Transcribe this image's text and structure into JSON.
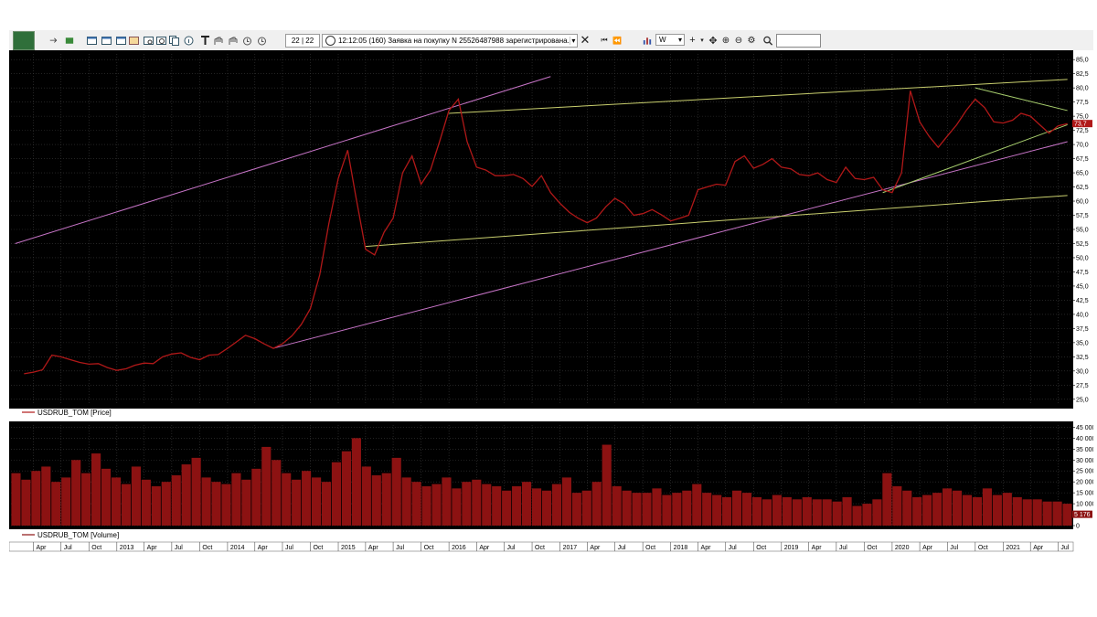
{
  "toolbar": {
    "counter": "22 | 22",
    "message": "12:12:05  (160) Заявка на покупку N 25526487988 зарегистрирована.",
    "timeframe": "W",
    "icons": [
      "app-icon",
      "arrow-icon",
      "connect-icon",
      "window-icon",
      "window-icon",
      "window-icon",
      "portfolio-icon",
      "search-doc-icon",
      "zoom-doc-icon",
      "copy-icon",
      "info-icon",
      "text-tool-icon",
      "hand-icon",
      "hand-icon",
      "alarm-icon",
      "close-icon",
      "first-bar-icon",
      "prev-bar-icon",
      "chart-type-icon",
      "crosshair-icon",
      "move-icon",
      "zoom-in-icon",
      "zoom-out-icon",
      "settings-icon",
      "magnifier-icon"
    ]
  },
  "chart_data": [
    {
      "type": "line",
      "legend": "USDRUB_TOM [Price]",
      "color": "#b01818",
      "ylim": [
        24,
        86
      ],
      "y_ticks": [
        "25,0",
        "27,5",
        "30,0",
        "32,5",
        "35,0",
        "37,5",
        "40,0",
        "42,5",
        "45,0",
        "47,5",
        "50,0",
        "52,5",
        "55,0",
        "57,5",
        "60,0",
        "62,5",
        "65,0",
        "67,5",
        "70,0",
        "72,5",
        "75,0",
        "77,5",
        "80,0",
        "82,5",
        "85,0"
      ],
      "last_value": "73,7",
      "points": [
        [
          "2012-03",
          29.5
        ],
        [
          "2012-04",
          29.8
        ],
        [
          "2012-05",
          30.2
        ],
        [
          "2012-06",
          32.8
        ],
        [
          "2012-07",
          32.5
        ],
        [
          "2012-08",
          32.0
        ],
        [
          "2012-09",
          31.5
        ],
        [
          "2012-10",
          31.2
        ],
        [
          "2012-11",
          31.3
        ],
        [
          "2012-12",
          30.6
        ],
        [
          "2013-01",
          30.1
        ],
        [
          "2013-02",
          30.4
        ],
        [
          "2013-03",
          31.0
        ],
        [
          "2013-04",
          31.4
        ],
        [
          "2013-05",
          31.3
        ],
        [
          "2013-06",
          32.5
        ],
        [
          "2013-07",
          33.0
        ],
        [
          "2013-08",
          33.2
        ],
        [
          "2013-09",
          32.4
        ],
        [
          "2013-10",
          32.0
        ],
        [
          "2013-11",
          32.8
        ],
        [
          "2013-12",
          32.9
        ],
        [
          "2014-01",
          34.0
        ],
        [
          "2014-02",
          35.2
        ],
        [
          "2014-03",
          36.3
        ],
        [
          "2014-04",
          35.7
        ],
        [
          "2014-05",
          34.8
        ],
        [
          "2014-06",
          34.0
        ],
        [
          "2014-07",
          34.8
        ],
        [
          "2014-08",
          36.2
        ],
        [
          "2014-09",
          38.2
        ],
        [
          "2014-10",
          41.0
        ],
        [
          "2014-11",
          47.0
        ],
        [
          "2014-12",
          56.0
        ],
        [
          "2015-01",
          64.0
        ],
        [
          "2015-02",
          69.0
        ],
        [
          "2015-03",
          60.5
        ],
        [
          "2015-04",
          51.5
        ],
        [
          "2015-05",
          50.5
        ],
        [
          "2015-06",
          54.5
        ],
        [
          "2015-07",
          57.0
        ],
        [
          "2015-08",
          65.0
        ],
        [
          "2015-09",
          68.0
        ],
        [
          "2015-10",
          63.0
        ],
        [
          "2015-11",
          65.5
        ],
        [
          "2015-12",
          70.5
        ],
        [
          "2016-01",
          76.0
        ],
        [
          "2016-02",
          78.0
        ],
        [
          "2016-03",
          70.5
        ],
        [
          "2016-04",
          66.0
        ],
        [
          "2016-05",
          65.5
        ],
        [
          "2016-06",
          64.5
        ],
        [
          "2016-07",
          64.5
        ],
        [
          "2016-08",
          64.7
        ],
        [
          "2016-09",
          64.0
        ],
        [
          "2016-10",
          62.6
        ],
        [
          "2016-11",
          64.5
        ],
        [
          "2016-12",
          61.5
        ],
        [
          "2017-01",
          59.6
        ],
        [
          "2017-02",
          58.0
        ],
        [
          "2017-03",
          57.0
        ],
        [
          "2017-04",
          56.2
        ],
        [
          "2017-05",
          57.0
        ],
        [
          "2017-06",
          59.0
        ],
        [
          "2017-07",
          60.5
        ],
        [
          "2017-08",
          59.5
        ],
        [
          "2017-09",
          57.5
        ],
        [
          "2017-10",
          57.8
        ],
        [
          "2017-11",
          58.5
        ],
        [
          "2017-12",
          57.6
        ],
        [
          "2018-01",
          56.5
        ],
        [
          "2018-02",
          57.0
        ],
        [
          "2018-03",
          57.5
        ],
        [
          "2018-04",
          62.0
        ],
        [
          "2018-05",
          62.5
        ],
        [
          "2018-06",
          63.0
        ],
        [
          "2018-07",
          62.8
        ],
        [
          "2018-08",
          67.0
        ],
        [
          "2018-09",
          68.0
        ],
        [
          "2018-10",
          65.8
        ],
        [
          "2018-11",
          66.5
        ],
        [
          "2018-12",
          67.5
        ],
        [
          "2019-01",
          66.0
        ],
        [
          "2019-02",
          65.7
        ],
        [
          "2019-03",
          64.7
        ],
        [
          "2019-04",
          64.5
        ],
        [
          "2019-05",
          65.0
        ],
        [
          "2019-06",
          63.8
        ],
        [
          "2019-07",
          63.3
        ],
        [
          "2019-08",
          66.0
        ],
        [
          "2019-09",
          64.0
        ],
        [
          "2019-10",
          63.8
        ],
        [
          "2019-11",
          64.2
        ],
        [
          "2019-12",
          62.0
        ],
        [
          "2020-01",
          61.5
        ],
        [
          "2020-02",
          65.0
        ],
        [
          "2020-03",
          79.5
        ],
        [
          "2020-04",
          74.0
        ],
        [
          "2020-05",
          71.5
        ],
        [
          "2020-06",
          69.5
        ],
        [
          "2020-07",
          71.5
        ],
        [
          "2020-08",
          73.5
        ],
        [
          "2020-09",
          76.0
        ],
        [
          "2020-10",
          78.0
        ],
        [
          "2020-11",
          76.5
        ],
        [
          "2020-12",
          74.0
        ],
        [
          "2021-01",
          73.8
        ],
        [
          "2021-02",
          74.3
        ],
        [
          "2021-03",
          75.5
        ],
        [
          "2021-04",
          75.0
        ],
        [
          "2021-05",
          73.5
        ],
        [
          "2021-06",
          72.0
        ],
        [
          "2021-07",
          73.3
        ],
        [
          "2021-08",
          73.7
        ]
      ],
      "trendlines": [
        {
          "color": "#c774c7",
          "from": [
            "2012-02",
            52.5
          ],
          "to": [
            "2016-12",
            82.0
          ]
        },
        {
          "color": "#c774c7",
          "from": [
            "2014-06",
            34.0
          ],
          "to": [
            "2021-08",
            70.5
          ]
        },
        {
          "color": "#c9cf6e",
          "from": [
            "2015-04",
            52.0
          ],
          "to": [
            "2021-08",
            61.0
          ]
        },
        {
          "color": "#c9cf6e",
          "from": [
            "2016-01",
            75.5
          ],
          "to": [
            "2021-08",
            81.5
          ]
        },
        {
          "color": "#a8cf6e",
          "from": [
            "2019-12",
            61.5
          ],
          "to": [
            "2021-08",
            73.5
          ]
        },
        {
          "color": "#a8cf6e",
          "from": [
            "2020-10",
            80.0
          ],
          "to": [
            "2021-08",
            76.0
          ]
        }
      ]
    },
    {
      "type": "bar",
      "legend": "USDRUB_TOM [Volume]",
      "color": "#8c1212",
      "ylim": [
        0,
        46000
      ],
      "y_ticks": [
        "0",
        "5 000",
        "10 000",
        "15 000",
        "20 000",
        "25 000",
        "30 000",
        "35 000",
        "40 000",
        "45 000"
      ],
      "last_value": "5 176",
      "values": [
        24000,
        21000,
        25000,
        27000,
        20000,
        22000,
        30000,
        24000,
        33000,
        26000,
        22000,
        19000,
        27000,
        21000,
        18000,
        20000,
        23000,
        28000,
        31000,
        22000,
        20000,
        19000,
        24000,
        21000,
        26000,
        36000,
        30000,
        24000,
        21000,
        25000,
        22000,
        20000,
        29000,
        34000,
        40000,
        27000,
        23000,
        24000,
        31000,
        22000,
        20000,
        18000,
        19000,
        22000,
        17000,
        20000,
        21000,
        19000,
        18000,
        16000,
        18000,
        20000,
        17000,
        16000,
        19000,
        22000,
        15000,
        16000,
        20000,
        37000,
        18000,
        16000,
        15000,
        15000,
        17000,
        14000,
        15000,
        16000,
        19000,
        15000,
        14000,
        13000,
        16000,
        15000,
        13000,
        12000,
        14000,
        13000,
        12000,
        13000,
        12000,
        12000,
        11000,
        13000,
        9000,
        10000,
        12000,
        24000,
        18000,
        16000,
        13000,
        14000,
        15000,
        17000,
        16000,
        14000,
        13000,
        17000,
        14000,
        15000,
        13000,
        12000,
        12000,
        11000,
        11000,
        10000
      ]
    }
  ],
  "x_axis": {
    "labels": [
      {
        "t": "Apr",
        "d": "2012-04"
      },
      {
        "t": "Jul",
        "d": "2012-07"
      },
      {
        "t": "Oct",
        "d": "2012-10"
      },
      {
        "t": "2013",
        "d": "2013-01"
      },
      {
        "t": "Apr",
        "d": "2013-04"
      },
      {
        "t": "Jul",
        "d": "2013-07"
      },
      {
        "t": "Oct",
        "d": "2013-10"
      },
      {
        "t": "2014",
        "d": "2014-01"
      },
      {
        "t": "Apr",
        "d": "2014-04"
      },
      {
        "t": "Jul",
        "d": "2014-07"
      },
      {
        "t": "Oct",
        "d": "2014-10"
      },
      {
        "t": "2015",
        "d": "2015-01"
      },
      {
        "t": "Apr",
        "d": "2015-04"
      },
      {
        "t": "Jul",
        "d": "2015-07"
      },
      {
        "t": "Oct",
        "d": "2015-10"
      },
      {
        "t": "2016",
        "d": "2016-01"
      },
      {
        "t": "Apr",
        "d": "2016-04"
      },
      {
        "t": "Jul",
        "d": "2016-07"
      },
      {
        "t": "Oct",
        "d": "2016-10"
      },
      {
        "t": "2017",
        "d": "2017-01"
      },
      {
        "t": "Apr",
        "d": "2017-04"
      },
      {
        "t": "Jul",
        "d": "2017-07"
      },
      {
        "t": "Oct",
        "d": "2017-10"
      },
      {
        "t": "2018",
        "d": "2018-01"
      },
      {
        "t": "Apr",
        "d": "2018-04"
      },
      {
        "t": "Jul",
        "d": "2018-07"
      },
      {
        "t": "Oct",
        "d": "2018-10"
      },
      {
        "t": "2019",
        "d": "2019-01"
      },
      {
        "t": "Apr",
        "d": "2019-04"
      },
      {
        "t": "Jul",
        "d": "2019-07"
      },
      {
        "t": "Oct",
        "d": "2019-10"
      },
      {
        "t": "2020",
        "d": "2020-01"
      },
      {
        "t": "Apr",
        "d": "2020-04"
      },
      {
        "t": "Jul",
        "d": "2020-07"
      },
      {
        "t": "Oct",
        "d": "2020-10"
      },
      {
        "t": "2021",
        "d": "2021-01"
      },
      {
        "t": "Apr",
        "d": "2021-04"
      },
      {
        "t": "Jul",
        "d": "2021-07"
      }
    ]
  },
  "colors": {
    "background": "#000000",
    "grid": "#3a3a3a",
    "axis_text": "#000000",
    "toolbar": "#f0f0f0"
  }
}
